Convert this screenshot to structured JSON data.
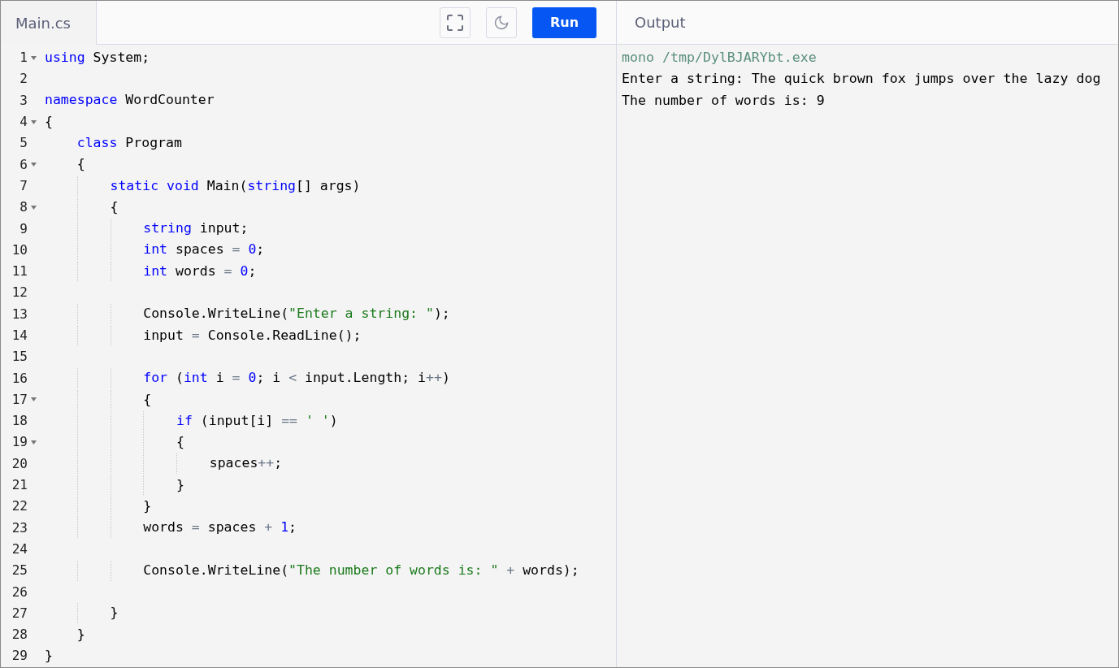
{
  "editor": {
    "tab": {
      "label": "Main.cs",
      "selected": true
    },
    "run_button": "Run",
    "lines": [
      {
        "number": "1",
        "fold": true,
        "tokens": [
          {
            "text": "using",
            "kind": "keyword"
          },
          {
            "text": " System;",
            "kind": "plain"
          }
        ]
      },
      {
        "number": "2",
        "fold": false
      },
      {
        "number": "3",
        "fold": false,
        "tokens": [
          {
            "text": "namespace",
            "kind": "keyword"
          },
          {
            "text": " WordCounter",
            "kind": "plain"
          }
        ]
      },
      {
        "number": "4",
        "fold": true,
        "tokens": [
          {
            "text": "{",
            "kind": "plain"
          }
        ]
      },
      {
        "number": "5",
        "fold": false,
        "tokens": [
          {
            "text": "    class",
            "kind": "keyword"
          },
          {
            "text": " Program",
            "kind": "plain"
          }
        ]
      },
      {
        "number": "6",
        "fold": true,
        "tokens": [
          {
            "text": "    {",
            "kind": "plain"
          }
        ]
      },
      {
        "number": "7",
        "fold": false,
        "tokens": [
          {
            "text": "        static",
            "kind": "keyword"
          },
          {
            "text": " void",
            "kind": "keyword"
          },
          {
            "text": " Main(",
            "kind": "plain"
          },
          {
            "text": "string",
            "kind": "keyword"
          },
          {
            "text": "[] args)",
            "kind": "plain"
          }
        ]
      },
      {
        "number": "8",
        "fold": true,
        "tokens": [
          {
            "text": "        {",
            "kind": "plain"
          }
        ]
      },
      {
        "number": "9",
        "fold": false,
        "tokens": [
          {
            "text": "            string",
            "kind": "keyword"
          },
          {
            "text": " input;",
            "kind": "plain"
          }
        ]
      },
      {
        "number": "10",
        "fold": false,
        "tokens": [
          {
            "text": "            int",
            "kind": "keyword"
          },
          {
            "text": " spaces ",
            "kind": "plain"
          },
          {
            "text": "=",
            "kind": "operator"
          },
          {
            "text": " 0",
            "kind": "number"
          },
          {
            "text": ";",
            "kind": "plain"
          }
        ]
      },
      {
        "number": "11",
        "fold": false,
        "tokens": [
          {
            "text": "            int",
            "kind": "keyword"
          },
          {
            "text": " words ",
            "kind": "plain"
          },
          {
            "text": "=",
            "kind": "operator"
          },
          {
            "text": " 0",
            "kind": "number"
          },
          {
            "text": ";",
            "kind": "plain"
          }
        ]
      },
      {
        "number": "12",
        "fold": false
      },
      {
        "number": "13",
        "fold": false,
        "tokens": [
          {
            "text": "            Console.WriteLine(",
            "kind": "plain"
          },
          {
            "text": "\"Enter a string: \"",
            "kind": "string"
          },
          {
            "text": ");",
            "kind": "plain"
          }
        ]
      },
      {
        "number": "14",
        "fold": false,
        "tokens": [
          {
            "text": "            input ",
            "kind": "plain"
          },
          {
            "text": "=",
            "kind": "operator"
          },
          {
            "text": " Console.ReadLine();",
            "kind": "plain"
          }
        ]
      },
      {
        "number": "15",
        "fold": false
      },
      {
        "number": "16",
        "fold": false,
        "tokens": [
          {
            "text": "            for",
            "kind": "keyword"
          },
          {
            "text": " (",
            "kind": "plain"
          },
          {
            "text": "int",
            "kind": "keyword"
          },
          {
            "text": " i ",
            "kind": "plain"
          },
          {
            "text": "=",
            "kind": "operator"
          },
          {
            "text": " 0",
            "kind": "number"
          },
          {
            "text": "; i ",
            "kind": "plain"
          },
          {
            "text": "<",
            "kind": "operator"
          },
          {
            "text": " input.Length; i",
            "kind": "plain"
          },
          {
            "text": "++",
            "kind": "operator"
          },
          {
            "text": ")",
            "kind": "plain"
          }
        ]
      },
      {
        "number": "17",
        "fold": true,
        "tokens": [
          {
            "text": "            {",
            "kind": "plain"
          }
        ]
      },
      {
        "number": "18",
        "fold": false,
        "tokens": [
          {
            "text": "                if",
            "kind": "keyword"
          },
          {
            "text": " (input[i] ",
            "kind": "plain"
          },
          {
            "text": "==",
            "kind": "operator"
          },
          {
            "text": " ' '",
            "kind": "string"
          },
          {
            "text": ")",
            "kind": "plain"
          }
        ]
      },
      {
        "number": "19",
        "fold": true,
        "tokens": [
          {
            "text": "                {",
            "kind": "plain"
          }
        ]
      },
      {
        "number": "20",
        "fold": false,
        "tokens": [
          {
            "text": "                    spaces",
            "kind": "plain"
          },
          {
            "text": "++",
            "kind": "operator"
          },
          {
            "text": ";",
            "kind": "plain"
          }
        ]
      },
      {
        "number": "21",
        "fold": false,
        "tokens": [
          {
            "text": "                }",
            "kind": "plain"
          }
        ]
      },
      {
        "number": "22",
        "fold": false,
        "tokens": [
          {
            "text": "            }",
            "kind": "plain"
          }
        ]
      },
      {
        "number": "23",
        "fold": false,
        "tokens": [
          {
            "text": "            words ",
            "kind": "plain"
          },
          {
            "text": "=",
            "kind": "operator"
          },
          {
            "text": " spaces ",
            "kind": "plain"
          },
          {
            "text": "+",
            "kind": "operator"
          },
          {
            "text": " 1",
            "kind": "number"
          },
          {
            "text": ";",
            "kind": "plain"
          }
        ]
      },
      {
        "number": "24",
        "fold": false
      },
      {
        "number": "25",
        "fold": false,
        "tokens": [
          {
            "text": "            Console.WriteLine(",
            "kind": "plain"
          },
          {
            "text": "\"The number of words is: \"",
            "kind": "string"
          },
          {
            "text": " +",
            "kind": "operator"
          },
          {
            "text": " words);",
            "kind": "plain"
          }
        ]
      },
      {
        "number": "26",
        "fold": false
      },
      {
        "number": "27",
        "fold": false,
        "tokens": [
          {
            "text": "        }",
            "kind": "plain"
          }
        ]
      },
      {
        "number": "28",
        "fold": false,
        "tokens": [
          {
            "text": "    }",
            "kind": "plain"
          }
        ]
      },
      {
        "number": "29",
        "fold": false,
        "tokens": [
          {
            "text": "}",
            "kind": "plain"
          }
        ]
      }
    ]
  },
  "output": {
    "title": "Output",
    "lines": [
      {
        "text": "mono /tmp/DylBJARYbt.exe",
        "kind": "command"
      },
      {
        "text": "Enter a string: The quick brown fox jumps over the lazy dog",
        "kind": "stdout"
      },
      {
        "text": "The number of words is: 9",
        "kind": "stdout"
      }
    ]
  }
}
